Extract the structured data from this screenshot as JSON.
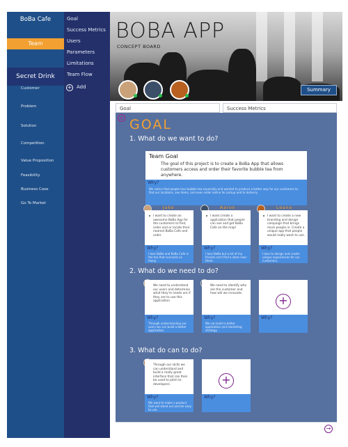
{
  "sidebar": {
    "title": "BoBa Cafe",
    "team_label": "Team",
    "section_title": "Secret Drink",
    "items": [
      {
        "label": "Customer"
      },
      {
        "label": "Problem"
      },
      {
        "label": "Solution"
      },
      {
        "label": "Competition"
      },
      {
        "label": "Value Proposition"
      },
      {
        "label": "Feasibility"
      },
      {
        "label": "Business Case"
      },
      {
        "label": "Go To Market"
      }
    ]
  },
  "board_nav": {
    "items": [
      {
        "label": "Goal"
      },
      {
        "label": "Success Metrics"
      },
      {
        "label": "Users"
      },
      {
        "label": "Parameters"
      },
      {
        "label": "Limitations"
      },
      {
        "label": "Team Flow"
      }
    ],
    "add_label": "Add"
  },
  "header": {
    "title": "BOBA APP",
    "subtitle": "CONCEPT BOARD",
    "summary_label": "Summary"
  },
  "tabs": [
    {
      "label": "Goal"
    },
    {
      "label": "Success Metrics"
    }
  ],
  "goal_modal": {
    "title": "GOAL",
    "questions": [
      "1. What do we want to do?",
      "2. What do we need to do?",
      "3. What do can to do?"
    ],
    "team_goal": {
      "title": "Team Goal",
      "text": "The goal of this project is to create a BoBa App that allows customers access and order their favorite bubble tea from anywhere.",
      "why_label": "Why?",
      "why_text": "We notice that people love bubble tea especially and wanted to produce a better way for our customers to find our locations, see items, and even order online for pickup and to delivery."
    },
    "members": [
      {
        "name": "Jake",
        "text": "I want to create an awesome BoBa App for the customers to find, order and or locate their nearest BoBa Cafe and order.",
        "why_label": "Why?",
        "why_text": "I love BoBa and BoBa Cafe is the tea that connects so many."
      },
      {
        "name": "Aaron",
        "text": "I want create a application that people can see and get BoBa Cafe on the map!",
        "why_label": "Why?",
        "why_text": "I love BoBa but a lot of my friends can't find a store near them."
      },
      {
        "name": "Leana",
        "text": "I want to create a new branding and design campaign that brings more people in. Create a unique app that people would really want to use.",
        "why_label": "Why?",
        "why_text": "I love to design and create unique experiences for our customers."
      }
    ],
    "needs": [
      {
        "text": "We need to understand our users and determine what they're needs are if they are to use this application.",
        "why_label": "Why?",
        "why_text": "Through understanding our users we can build a better application."
      },
      {
        "text": "We need to identify who are the customer and how will we innovate.",
        "why_label": "Why?",
        "why_text": "We can build a better application and marketing strategy."
      },
      {
        "plus": "+",
        "why_label": "Why?"
      }
    ],
    "cans": [
      {
        "text": "Through our skills we can understand and build a really great interface that can then be used to pitch to developers.",
        "why_label": "Why?",
        "why_text": "We want to make a product that will stand out and be easy to use."
      },
      {
        "plus": "+",
        "why_label": "Why?"
      }
    ]
  },
  "colors": {
    "accent_orange": "#f2a031",
    "sidebar_blue": "#1f4f88",
    "nav_navy": "#24306a",
    "modal_blue": "#56709f",
    "why_blue": "#4a8ee0",
    "purple": "#7a1d8a",
    "online_green": "#27c24c"
  },
  "icons": {
    "close": "close-icon",
    "add": "plus-circle-icon",
    "next": "arrow-right-circle-icon"
  }
}
